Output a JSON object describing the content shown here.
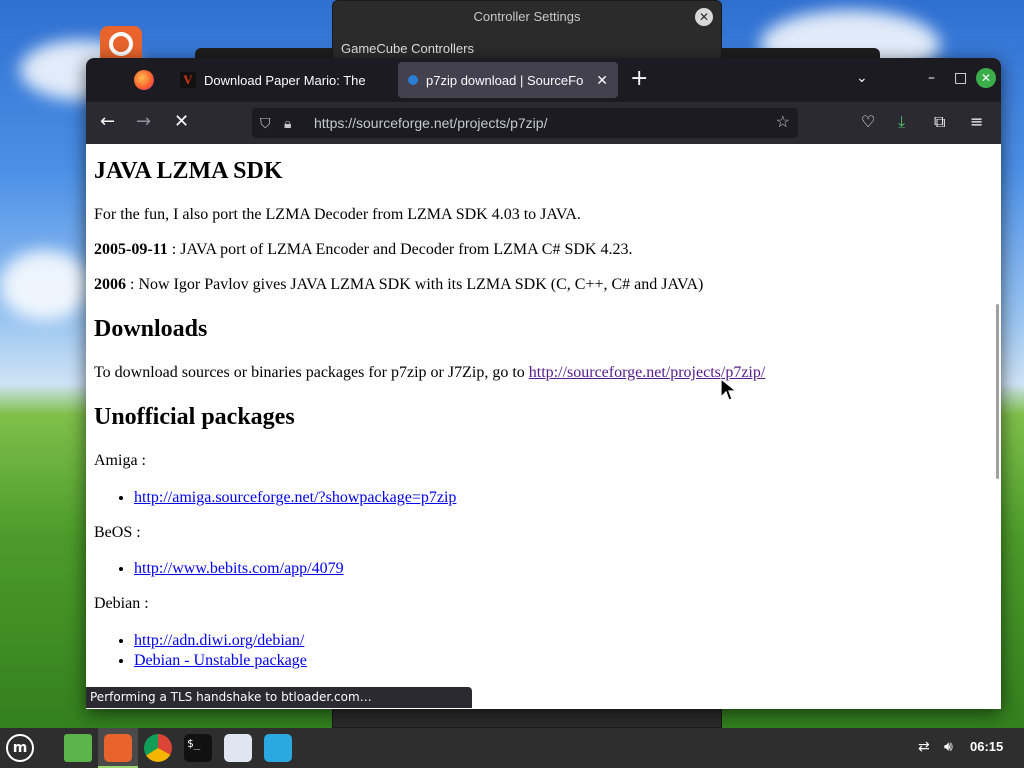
{
  "background_window": {
    "title": "Controller Settings",
    "section": "GameCube Controllers"
  },
  "browser": {
    "tabs": [
      {
        "label": "Download Paper Mario: The"
      },
      {
        "label": "p7zip download | SourceFo"
      }
    ],
    "url": "https://sourceforge.net/projects/p7zip/",
    "status": "Performing a TLS handshake to btloader.com…"
  },
  "page": {
    "h_java": "JAVA LZMA SDK",
    "p_fun": "For the fun, I also port the LZMA Decoder from LZMA SDK 4.03 to JAVA.",
    "date1": "2005-09-11",
    "p_date1": " : JAVA port of LZMA Encoder and Decoder from LZMA C# SDK 4.23.",
    "date2": "2006",
    "p_date2": " : Now Igor Pavlov gives JAVA LZMA SDK with its LZMA SDK (C, C++, C# and JAVA)",
    "h_downloads": "Downloads",
    "p_download": "To download sources or binaries packages for p7zip or J7Zip, go to ",
    "download_link": "http://sourceforge.net/projects/p7zip/",
    "h_unofficial": "Unofficial packages",
    "amiga_label": "Amiga :",
    "amiga_link": "http://amiga.sourceforge.net/?showpackage=p7zip",
    "beos_label": "BeOS :",
    "beos_link": "http://www.bebits.com/app/4079",
    "debian_label": "Debian :",
    "debian_links": [
      "http://adn.diwi.org/debian/",
      "Debian - Unstable package"
    ]
  },
  "taskbar": {
    "clock": "06:15"
  },
  "colors": {
    "link": "#0000ee",
    "visited_link": "#551a8b",
    "firefox_dark": "#1c1b22",
    "toolbar": "#2b2a33"
  }
}
